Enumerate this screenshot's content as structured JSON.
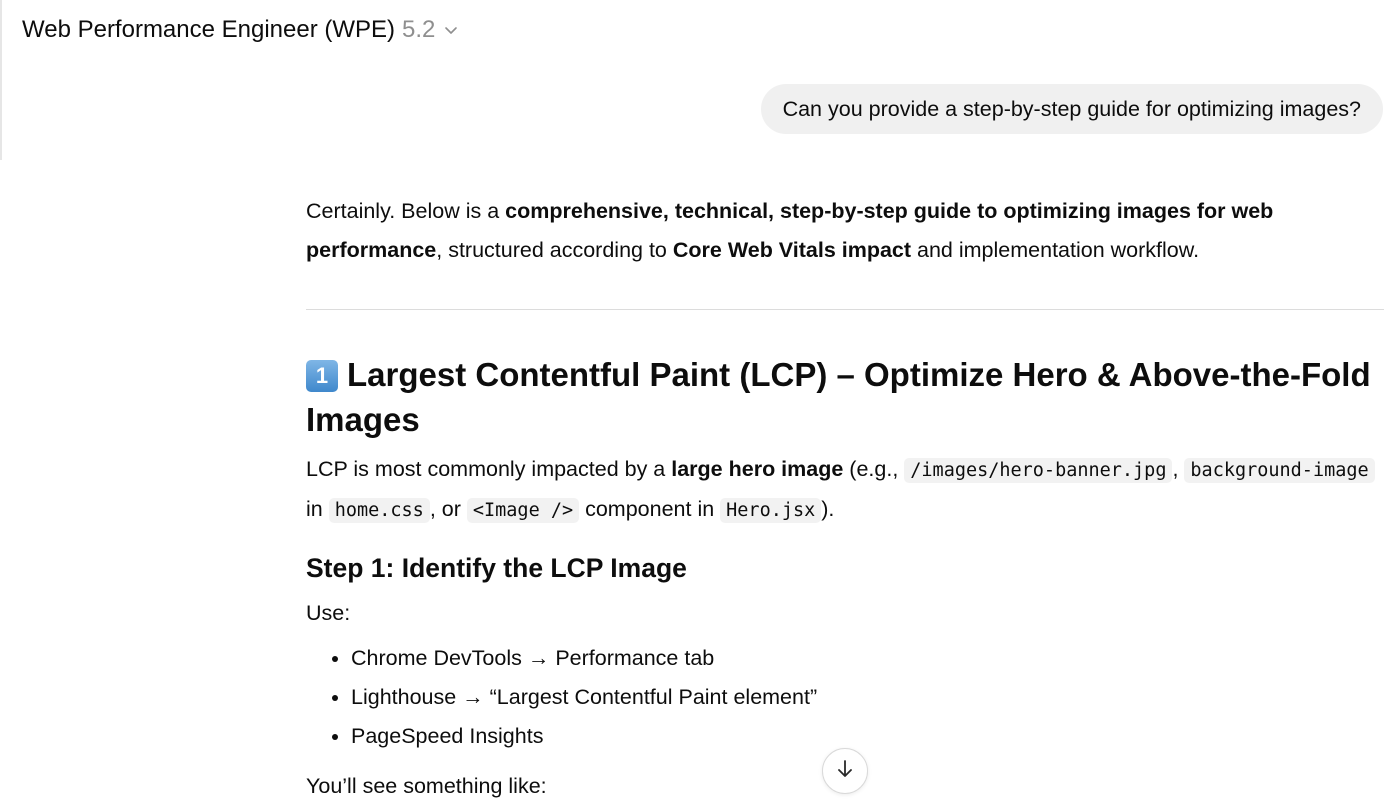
{
  "header": {
    "title": "Web Performance Engineer (WPE)",
    "version": "5.2",
    "dropdown_icon": "chevron-down-icon"
  },
  "user_message": "Can you provide a step-by-step guide for optimizing images?",
  "answer": {
    "intro": {
      "t1": "Certainly. Below is a ",
      "b1": "comprehensive, technical, step-by-step guide to optimizing images for web performance",
      "t2": ", structured according to ",
      "b2": "Core Web Vitals impact",
      "t3": " and implementation workflow."
    },
    "section1": {
      "badge": "1",
      "heading": "Largest Contentful Paint (LCP) – Optimize Hero & Above-the-Fold Images",
      "para": {
        "t1": "LCP is most commonly impacted by a ",
        "b1": "large hero image",
        "t2": " (e.g., ",
        "c1": "/images/hero-banner.jpg",
        "t3": ", ",
        "c2": "background-image",
        "t4": " in ",
        "c3": "home.css",
        "t5": ", or ",
        "c4": "<Image />",
        "t6": " component in ",
        "c5": "Hero.jsx",
        "t7": ")."
      },
      "step1_heading": "Step 1: Identify the LCP Image",
      "use_label": "Use:",
      "bullets": [
        "Chrome DevTools → Performance tab",
        "Lighthouse → “Largest Contentful Paint element”",
        "PageSpeed Insights"
      ],
      "see_label": "You’ll see something like:"
    }
  },
  "scroll_button_icon": "arrow-down-icon"
}
